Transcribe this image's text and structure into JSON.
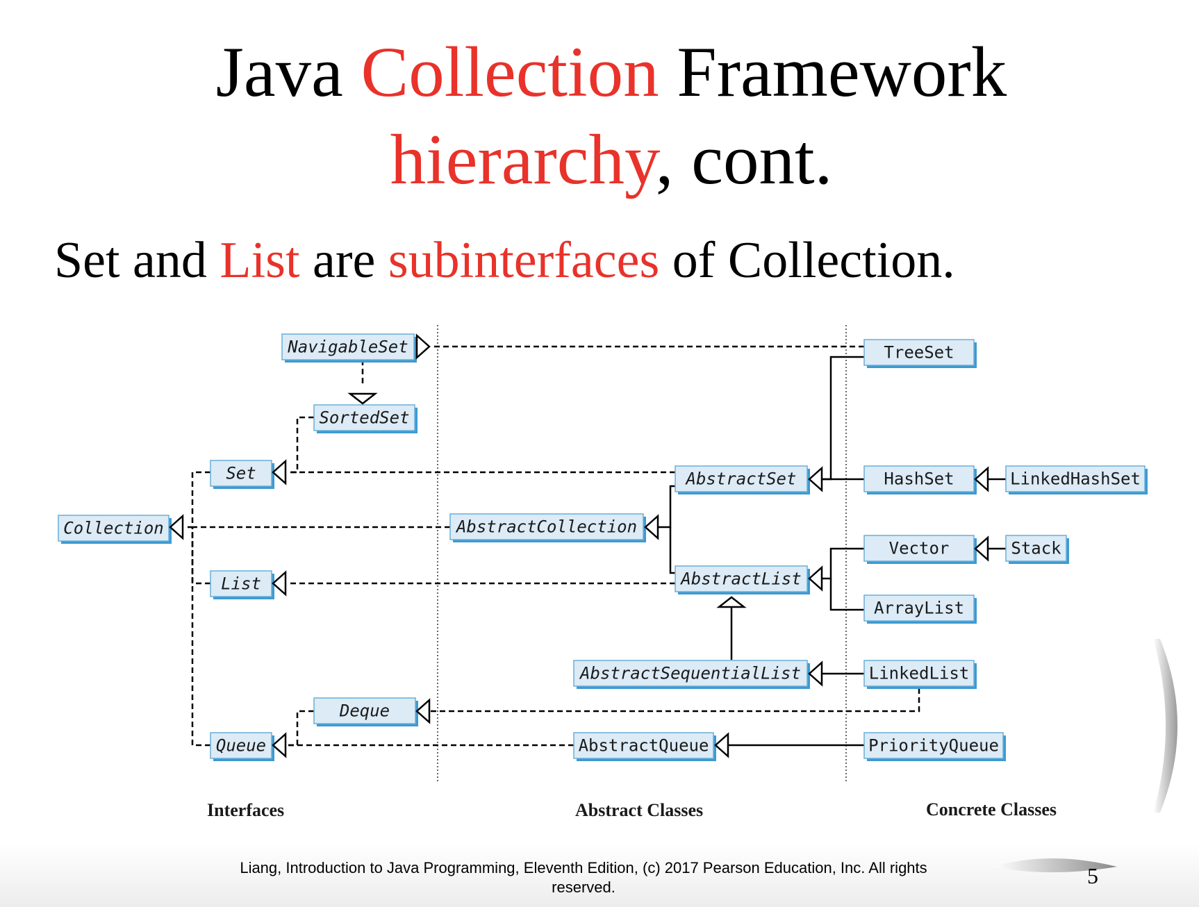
{
  "title": {
    "line1": [
      "Java ",
      "Collection",
      " Framework"
    ],
    "line2": [
      "hierarchy",
      ", cont."
    ]
  },
  "subtitle": [
    "Set and ",
    "List",
    " are ",
    "subinterfaces",
    " of Collection."
  ],
  "colors": {
    "accent_red": "#e8322a",
    "node_fill": "#dcebf6",
    "node_shadow": "#3d9ad1"
  },
  "nodes": {
    "navigableset": "NavigableSet",
    "sortedset": "SortedSet",
    "set": "Set",
    "collection": "Collection",
    "list": "List",
    "deque": "Deque",
    "queue": "Queue",
    "abstractcollection": "AbstractCollection",
    "abstractset": "AbstractSet",
    "abstractlist": "AbstractList",
    "abstractsequentiallist": "AbstractSequentialList",
    "abstractqueue": "AbstractQueue",
    "treeset": "TreeSet",
    "hashset": "HashSet",
    "linkedhashset": "LinkedHashSet",
    "vector": "Vector",
    "stack": "Stack",
    "arraylist": "ArrayList",
    "linkedlist": "LinkedList",
    "priorityqueue": "PriorityQueue"
  },
  "columns": {
    "interfaces": "Interfaces",
    "abstract": "Abstract Classes",
    "concrete": "Concrete Classes"
  },
  "footer": "Liang, Introduction to Java Programming, Eleventh Edition, (c) 2017 Pearson Education, Inc. All rights reserved.",
  "page_number": "5"
}
